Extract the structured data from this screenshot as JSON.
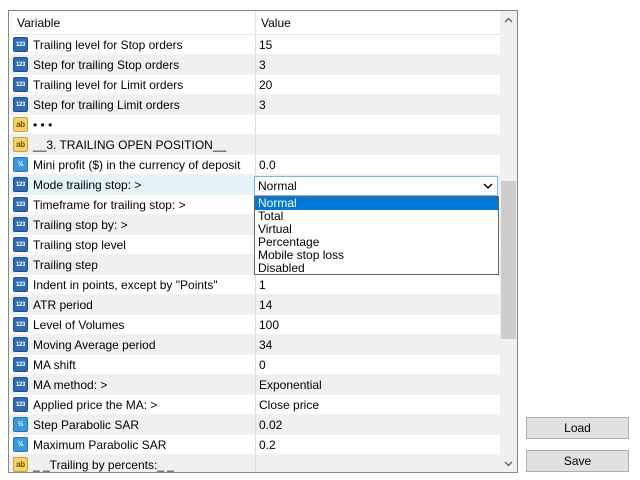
{
  "header": {
    "variable": "Variable",
    "value": "Value"
  },
  "rows": [
    {
      "type": "num",
      "name": "Trailing level for Stop orders",
      "value": "15"
    },
    {
      "type": "num",
      "name": "Step for trailing Stop orders",
      "value": "3"
    },
    {
      "type": "num",
      "name": "Trailing level for Limit orders",
      "value": "20"
    },
    {
      "type": "num",
      "name": "Step for trailing Limit orders",
      "value": "3"
    },
    {
      "type": "str",
      "name": "• • •",
      "value": ""
    },
    {
      "type": "str",
      "name": "__3. TRAILING OPEN POSITION__",
      "value": ""
    },
    {
      "type": "dbl",
      "name": "Mini profit ($) in the currency of deposit",
      "value": "0.0"
    },
    {
      "type": "num",
      "name": "Mode trailing stop: >",
      "value": "Normal"
    },
    {
      "type": "num",
      "name": "Timeframe for trailing stop: >",
      "value": ""
    },
    {
      "type": "num",
      "name": "Trailing stop by: >",
      "value": ""
    },
    {
      "type": "num",
      "name": "Trailing stop level",
      "value": ""
    },
    {
      "type": "num",
      "name": "Trailing step",
      "value": ""
    },
    {
      "type": "num",
      "name": "Indent in points, except by \"Points\"",
      "value": "1"
    },
    {
      "type": "num",
      "name": "ATR period",
      "value": "14"
    },
    {
      "type": "num",
      "name": "Level of Volumes",
      "value": "100"
    },
    {
      "type": "num",
      "name": "Moving Average period",
      "value": "34"
    },
    {
      "type": "num",
      "name": "MA shift",
      "value": "0"
    },
    {
      "type": "num",
      "name": "MA method: >",
      "value": "Exponential"
    },
    {
      "type": "num",
      "name": "Applied price the MA: >",
      "value": "Close price"
    },
    {
      "type": "dbl",
      "name": "Step Parabolic SAR",
      "value": "0.02"
    },
    {
      "type": "dbl",
      "name": "Maximum Parabolic SAR",
      "value": "0.2"
    },
    {
      "type": "str",
      "name": "_ _Trailing by percents:_ _",
      "value": ""
    }
  ],
  "icons": {
    "num": "123",
    "dbl": "½",
    "str": "ab"
  },
  "combo": {
    "selected": "Normal"
  },
  "dropdown": [
    "Normal",
    "Total",
    "Virtual",
    "Percentage",
    "Mobile stop loss",
    "Disabled"
  ],
  "buttons": {
    "load": "Load",
    "save": "Save"
  },
  "colors": {
    "selection": "#0078d7",
    "row_alt": "#f0f0f0",
    "int_icon": "#2f6bb5",
    "double_icon": "#3a9ad9",
    "string_icon": "#f4d36b"
  }
}
